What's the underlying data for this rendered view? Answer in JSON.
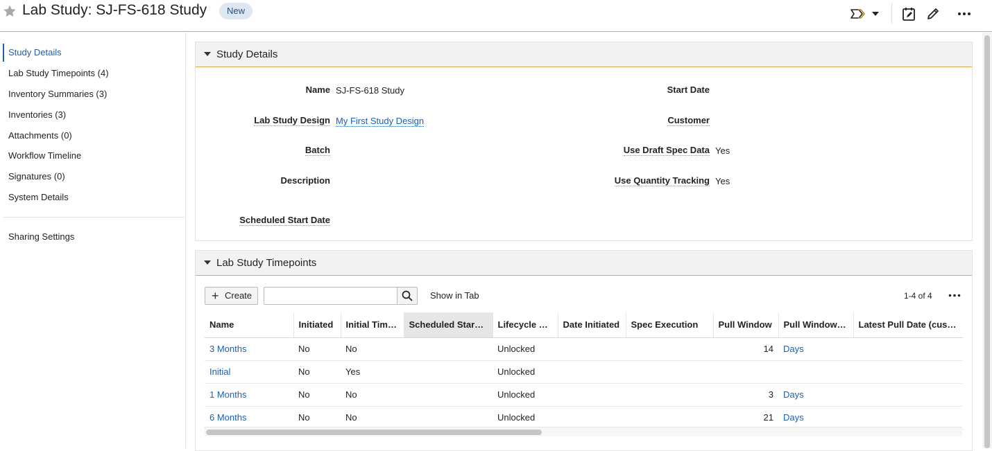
{
  "header": {
    "title": "Lab Study: SJ-FS-618 Study",
    "status_badge": "New"
  },
  "sidebar": {
    "items": [
      {
        "label": "Study Details"
      },
      {
        "label": "Lab Study Timepoints (4)"
      },
      {
        "label": "Inventory Summaries (3)"
      },
      {
        "label": "Inventories (3)"
      },
      {
        "label": "Attachments (0)"
      },
      {
        "label": "Workflow Timeline"
      },
      {
        "label": "Signatures (0)"
      },
      {
        "label": "System Details"
      }
    ],
    "sharing": "Sharing Settings"
  },
  "details": {
    "title": "Study Details",
    "name_label": "Name",
    "name_value": "SJ-FS-618 Study",
    "design_label": "Lab Study Design",
    "design_value": "My First Study Design",
    "batch_label": "Batch",
    "description_label": "Description",
    "sched_start_label": "Scheduled Start Date",
    "start_date_label": "Start Date",
    "customer_label": "Customer",
    "draft_spec_label": "Use Draft Spec Data",
    "draft_spec_value": "Yes",
    "qty_tracking_label": "Use Quantity Tracking",
    "qty_tracking_value": "Yes"
  },
  "timepoints": {
    "title": "Lab Study Timepoints",
    "create_label": "Create",
    "search_value": "",
    "search_placeholder": "",
    "show_in_tab": "Show in Tab",
    "pager": "1-4 of 4",
    "columns": [
      "Name",
      "Initiated",
      "Initial Time…",
      "Scheduled Star…",
      "Lifecycle St…",
      "Date Initiated",
      "Spec Execution",
      "Pull Window",
      "Pull Window …",
      "Latest Pull Date (cust…"
    ],
    "rows": [
      [
        "3 Months",
        "No",
        "No",
        "",
        "Unlocked",
        "",
        "",
        "14",
        "Days",
        ""
      ],
      [
        "Initial",
        "No",
        "Yes",
        "",
        "Unlocked",
        "",
        "",
        "",
        "",
        ""
      ],
      [
        "1 Months",
        "No",
        "No",
        "",
        "Unlocked",
        "",
        "",
        "3",
        "Days",
        ""
      ],
      [
        "6 Months",
        "No",
        "No",
        "",
        "Unlocked",
        "",
        "",
        "21",
        "Days",
        ""
      ]
    ]
  },
  "colors": {
    "accent": "#e8a24a",
    "link": "#1a5fb4",
    "badge_bg": "#dde6f3"
  },
  "icons": [
    "star-icon",
    "workflow-icon",
    "chevron-down-icon",
    "calendar-edit-icon",
    "pencil-icon",
    "more-icon",
    "search-icon",
    "plus-icon"
  ]
}
